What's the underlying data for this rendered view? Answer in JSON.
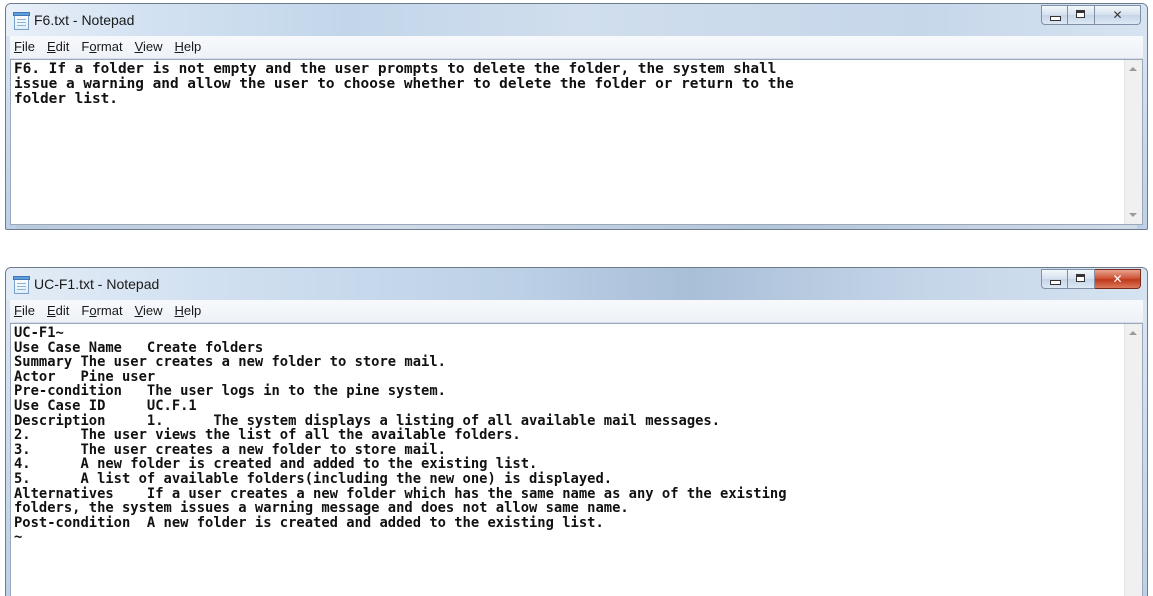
{
  "windows": [
    {
      "title": "F6.txt - Notepad",
      "menu": [
        "File",
        "Edit",
        "Format",
        "View",
        "Help"
      ],
      "menu_mnemonics": [
        "F",
        "E",
        "o",
        "V",
        "H"
      ],
      "controls": {
        "minimize": "minimize",
        "maximize": "maximize",
        "close": "✕"
      },
      "content": "F6. If a folder is not empty and the user prompts to delete the folder, the system shall\nissue a warning and allow the user to choose whether to delete the folder or return to the\nfolder list."
    },
    {
      "title": "UC-F1.txt - Notepad",
      "menu": [
        "File",
        "Edit",
        "Format",
        "View",
        "Help"
      ],
      "menu_mnemonics": [
        "F",
        "E",
        "o",
        "V",
        "H"
      ],
      "controls": {
        "minimize": "minimize",
        "maximize": "maximize",
        "close": "✕"
      },
      "content": "UC-F1~\nUse Case Name   Create folders\nSummary The user creates a new folder to store mail.\nActor   Pine user\nPre-condition   The user logs in to the pine system.\nUse Case ID     UC.F.1\nDescription     1.      The system displays a listing of all available mail messages.\n2.      The user views the list of all the available folders.\n3.      The user creates a new folder to store mail.\n4.      A new folder is created and added to the existing list.\n5.      A list of available folders(including the new one) is displayed.\nAlternatives    If a user creates a new folder which has the same name as any of the existing\nfolders, the system issues a warning message and does not allow same name.\nPost-condition  A new folder is created and added to the existing list.\n~"
    }
  ],
  "icons": {
    "app": "notepad-icon",
    "scroll_up": "scroll-up-arrow-icon",
    "scroll_down": "scroll-down-arrow-icon"
  },
  "colors": {
    "close_button_active": "#c0391c",
    "text": "#111111",
    "titlebar": "#c9d8ec"
  }
}
